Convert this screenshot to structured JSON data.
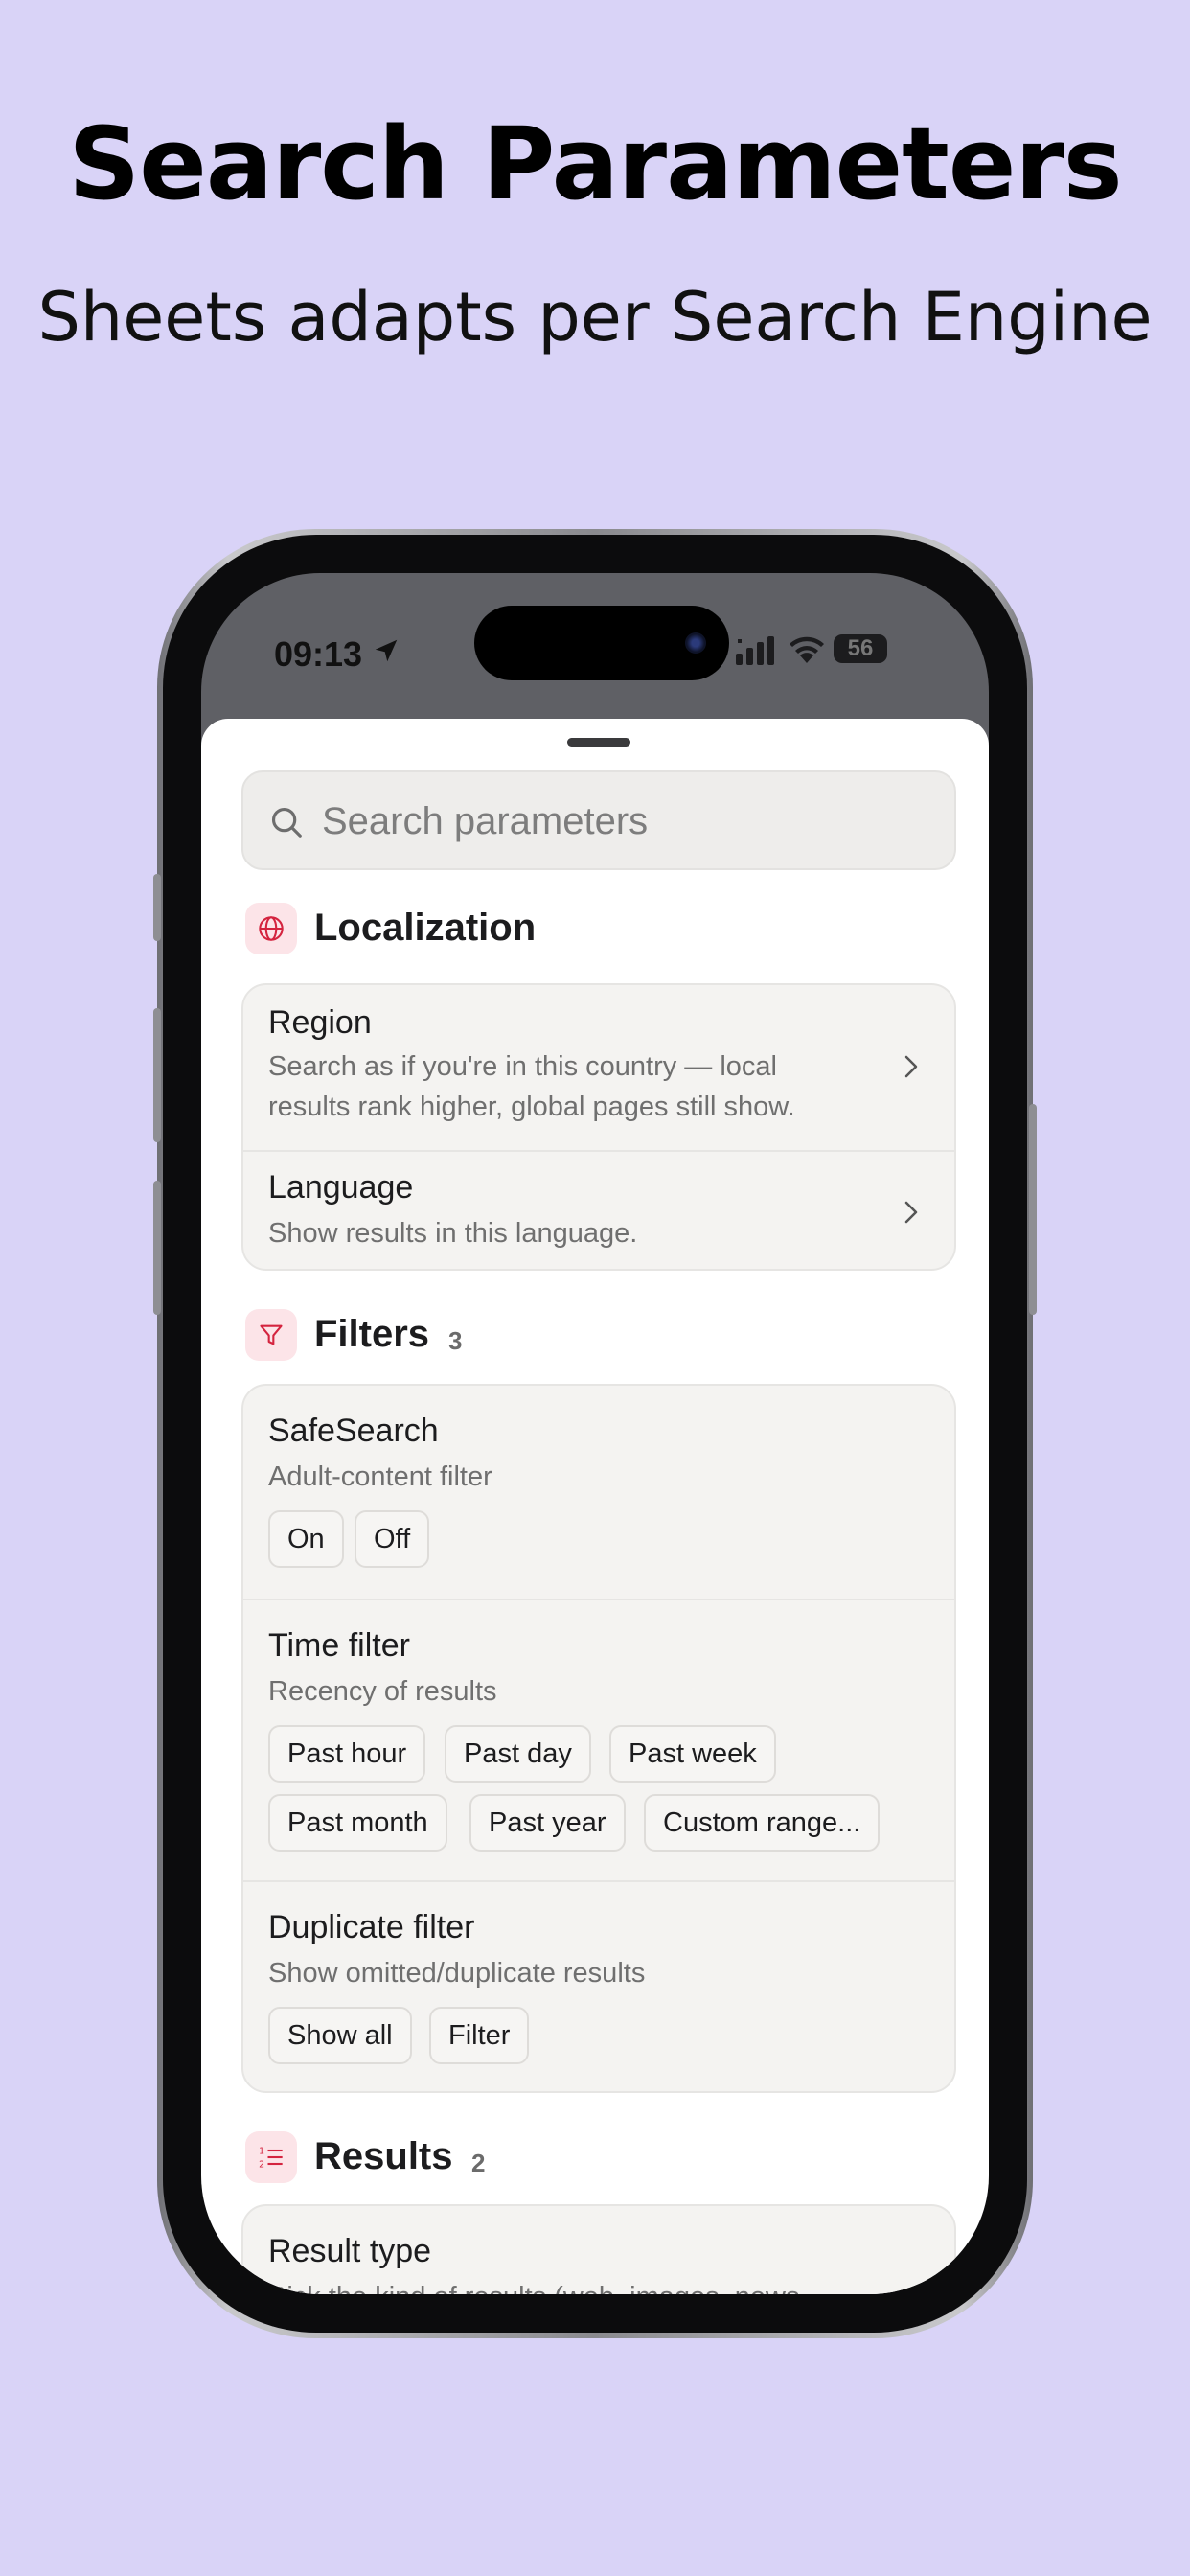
{
  "header": {
    "title": "Search Parameters",
    "subtitle": "Sheets adapts per Search Engine"
  },
  "status_bar": {
    "time": "09:13",
    "battery": "56"
  },
  "search": {
    "placeholder": "Search parameters"
  },
  "sections": {
    "localization": {
      "title": "Localization",
      "icon": "globe-icon",
      "rows": [
        {
          "title": "Region",
          "description": "Search as if you're in this country — local results rank higher, global pages still show."
        },
        {
          "title": "Language",
          "description": "Show results in this language."
        }
      ]
    },
    "filters": {
      "title": "Filters",
      "count": "3",
      "icon": "funnel-icon",
      "safesearch": {
        "title": "SafeSearch",
        "description": "Adult-content filter",
        "options": [
          "On",
          "Off"
        ]
      },
      "time_filter": {
        "title": "Time filter",
        "description": "Recency of results",
        "options": [
          "Past hour",
          "Past day",
          "Past week",
          "Past month",
          "Past year",
          "Custom range..."
        ]
      },
      "duplicate_filter": {
        "title": "Duplicate filter",
        "description": "Show omitted/duplicate results",
        "options": [
          "Show all",
          "Filter"
        ]
      }
    },
    "results": {
      "title": "Results",
      "count": "2",
      "icon": "numbered-list-icon",
      "result_type": {
        "title": "Result type",
        "description": "Pick the kind of results (web, images, news,"
      }
    }
  },
  "colors": {
    "background": "#d9d3f7",
    "accent": "#d4243f",
    "accent_bg": "#fce4e8"
  }
}
